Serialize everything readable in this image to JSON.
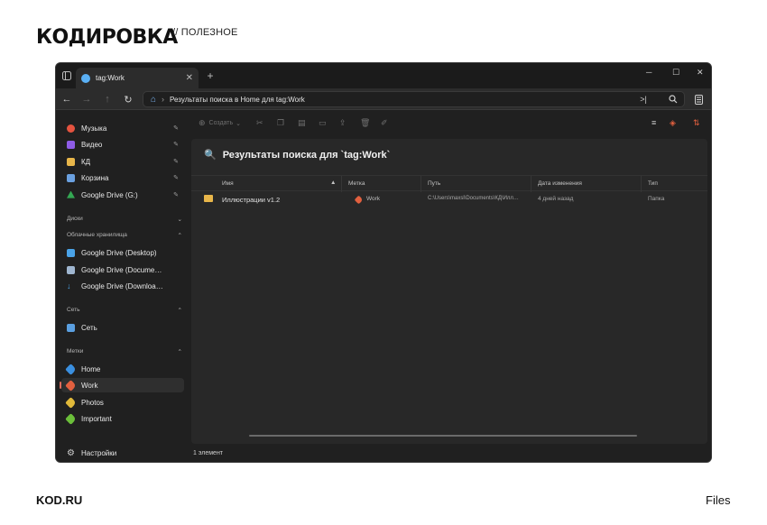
{
  "watermark": {
    "logo": "КОДИРОВКА",
    "category": "// ПОЛЕЗНОЕ",
    "site": "KOD.RU",
    "app_name": "Files"
  },
  "window": {
    "tab_title": "tag:Work",
    "tab_close": "✕",
    "new_tab": "+",
    "controls": {
      "minimize": "─",
      "maximize": "☐",
      "close": "✕"
    }
  },
  "address": {
    "path": "Результаты поиска в Home для tag:Work"
  },
  "sidebar": {
    "top_items": [
      {
        "label": "Музыка",
        "color": "#e5533f"
      },
      {
        "label": "Видео",
        "color": "#8e5ce6"
      },
      {
        "label": "КД",
        "color": "#e8b64a"
      },
      {
        "label": "Корзина",
        "color": "#6aa0e0"
      },
      {
        "label": "Google Drive (G:)",
        "color": "#34a853"
      }
    ],
    "sections": {
      "disks": "Диски",
      "cloud": "Облачные хранилища",
      "network": "Сеть",
      "tags": "Метки"
    },
    "cloud_items": [
      {
        "label": "Google Drive (Desktop)",
        "color": "#4aa3e8"
      },
      {
        "label": "Google Drive (Docume…",
        "color": "#9fb6d0"
      },
      {
        "label": "Google Drive (Downloa…",
        "color": "#4aa3e8"
      }
    ],
    "network_items": [
      {
        "label": "Сеть",
        "color": "#5a9fe0"
      }
    ],
    "tag_items": [
      {
        "label": "Home",
        "color": "#3a8fe0"
      },
      {
        "label": "Work",
        "color": "#e2603f"
      },
      {
        "label": "Photos",
        "color": "#e0b93a"
      },
      {
        "label": "Important",
        "color": "#6bbf3a"
      }
    ],
    "settings": "Настройки"
  },
  "toolbar": {
    "create": "Создать"
  },
  "results": {
    "title": "Результаты поиска для `tag:Work`",
    "columns": {
      "name": "Имя",
      "tag": "Метка",
      "path": "Путь",
      "modified": "Дата изменения",
      "type": "Тип"
    },
    "rows": [
      {
        "name": "Иллюстрации v1.2",
        "tag": "Work",
        "tag_color": "#e2603f",
        "path": "C:\\Users\\maxsl\\Documents\\КД\\Илл…",
        "modified": "4 дней назад",
        "type": "Папка"
      }
    ]
  },
  "status": {
    "count": "1 элемент"
  }
}
